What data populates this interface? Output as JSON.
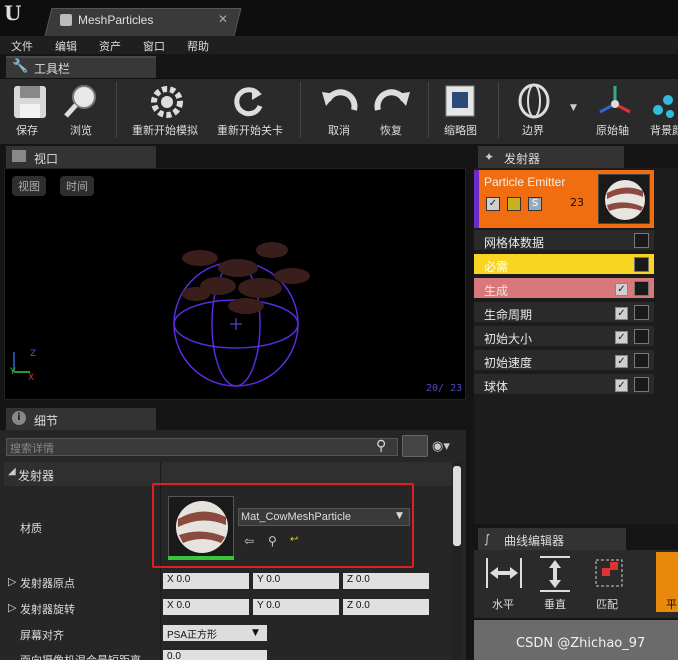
{
  "window": {
    "tab_title": "MeshParticles"
  },
  "menu": [
    "文件",
    "编辑",
    "资产",
    "窗口",
    "帮助"
  ],
  "toolbar": {
    "tab_label": "工具栏",
    "buttons": [
      {
        "label": "保存",
        "icon": "save-icon"
      },
      {
        "label": "浏览",
        "icon": "browse-icon"
      },
      {
        "label": "重新开始模拟",
        "icon": "restart-sim-icon"
      },
      {
        "label": "重新开始关卡",
        "icon": "restart-level-icon"
      },
      {
        "label": "取消",
        "icon": "undo-icon"
      },
      {
        "label": "恢复",
        "icon": "redo-icon"
      },
      {
        "label": "缩略图",
        "icon": "thumbnail-icon"
      },
      {
        "label": "边界",
        "icon": "bounds-icon"
      },
      {
        "label": "原始轴",
        "icon": "origin-axis-icon"
      },
      {
        "label": "背景颜",
        "icon": "background-color-icon"
      }
    ]
  },
  "viewport": {
    "tab_label": "视口",
    "buttons": [
      "视图",
      "时间"
    ],
    "counter": "20/ 23"
  },
  "details": {
    "tab_label": "细节",
    "search_placeholder": "搜索详情",
    "section": "发射器",
    "material_label": "材质",
    "material_value": "Mat_CowMeshParticle",
    "props": [
      {
        "label": "发射器原点",
        "x": "X 0.0",
        "y": "Y 0.0",
        "z": "Z 0.0"
      },
      {
        "label": "发射器旋转",
        "x": "X 0.0",
        "y": "Y 0.0",
        "z": "Z 0.0"
      }
    ],
    "screen_align_label": "屏幕对齐",
    "screen_align_value": "PSA正方形",
    "camera_label": "面向摄像机混合最短距离",
    "camera_value": "0.0"
  },
  "emitters": {
    "tab_label": "发射器",
    "emitter_name": "Particle Emitter",
    "particle_count": "23",
    "modules": [
      {
        "label": "网格体数据",
        "style": "normal",
        "has_check": false
      },
      {
        "label": "必需",
        "style": "required",
        "has_check": false
      },
      {
        "label": "生成",
        "style": "spawn",
        "has_check": true
      },
      {
        "label": "生命周期",
        "style": "normal",
        "has_check": true
      },
      {
        "label": "初始大小",
        "style": "normal",
        "has_check": true
      },
      {
        "label": "初始速度",
        "style": "normal",
        "has_check": true
      },
      {
        "label": "球体",
        "style": "normal",
        "has_check": true
      }
    ]
  },
  "curve_editor": {
    "tab_label": "曲线编辑器",
    "buttons": [
      "水平",
      "垂直",
      "匹配",
      "平"
    ]
  },
  "watermark": "CSDN @Zhichao_97",
  "colors": {
    "emitter_orange": "#f06d10",
    "required_yellow": "#f7d520",
    "spawn_red": "#d9787a",
    "accent_purple": "#6e2ac8"
  }
}
